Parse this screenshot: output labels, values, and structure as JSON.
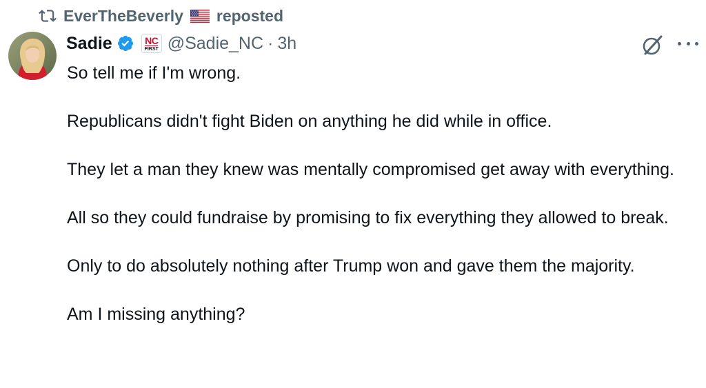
{
  "repost": {
    "user": "EverTheBeverly",
    "flag_icon": "us-flag-icon",
    "label": "reposted"
  },
  "author": {
    "display_name": "Sadie",
    "verified_icon": "verified-badge-icon",
    "affiliate_badge": {
      "top": "NC",
      "bottom": "FIRST"
    },
    "handle": "@Sadie_NC",
    "separator": "·",
    "time": "3h"
  },
  "actions": {
    "grok_icon": "grok-icon",
    "more_icon": "more-options-icon"
  },
  "post": {
    "paragraphs": [
      "So tell me if I'm wrong.",
      "Republicans didn't fight Biden on anything he did while in office.",
      "They let a man they knew was mentally compromised get away with everything.",
      "All so they could fundraise by promising to fix everything they allowed to break.",
      "Only to do absolutely nothing after Trump won and gave them the majority.",
      "Am I missing anything?"
    ]
  },
  "colors": {
    "text_primary": "#0f1419",
    "text_secondary": "#536471",
    "verified_blue": "#1d9bf0",
    "badge_red": "#c8102e"
  }
}
